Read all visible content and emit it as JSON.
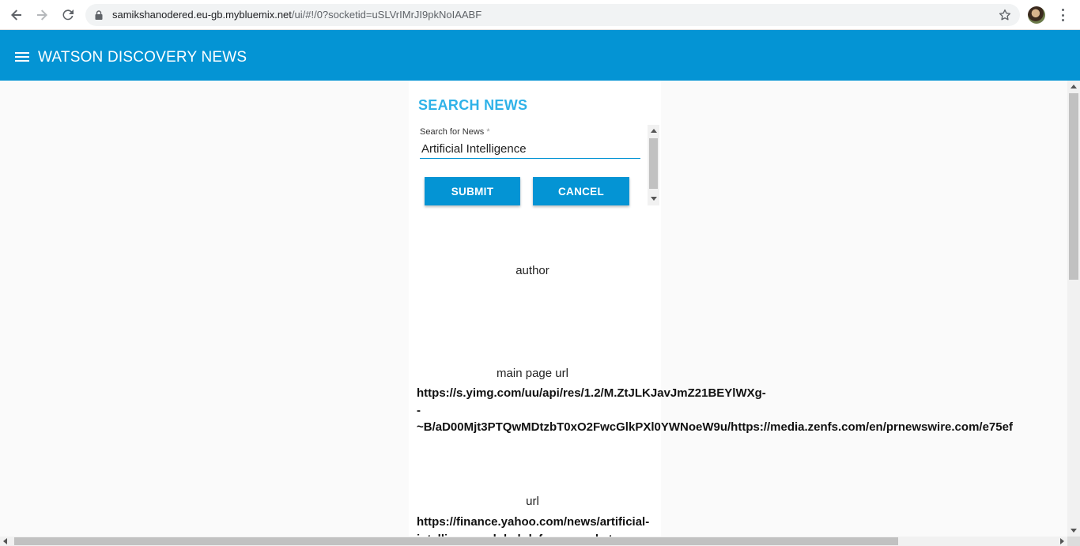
{
  "browser": {
    "url_host": "samikshanodered.eu-gb.mybluemix.net",
    "url_path": "/ui/#!/0?socketid=uSLVrIMrJI9pkNoIAABF"
  },
  "app": {
    "title": "WATSON DISCOVERY NEWS",
    "accent_color": "#0494d4"
  },
  "search": {
    "heading": "SEARCH NEWS",
    "field_label": "Search for News",
    "required_marker": "*",
    "value": "Artificial Intelligence",
    "submit_label": "SUBMIT",
    "cancel_label": "CANCEL"
  },
  "results": {
    "author_label": "author",
    "main_page_url_label": "main page url",
    "main_page_url_lines": [
      "https://s.yimg.com/uu/api/res/1.2/M.ZtJLKJavJmZ21BEYlWXg-",
      "-",
      "~B/aD00Mjt3PTQwMDtzbT0xO2FwcGlkPXl0YWNoeW9u/https://media.zenfs.com/en/prnewswire.com/e75ef"
    ],
    "url_label": "url",
    "url_lines": [
      "https://finance.yahoo.com/news/artificial-",
      "intelligence-global-defense-market"
    ]
  },
  "icons": {
    "back": "arrow-left-icon",
    "forward": "arrow-right-icon",
    "reload": "reload-icon",
    "lock": "lock-icon",
    "bookmark": "star-icon",
    "menu": "hamburger-menu-icon",
    "more": "kebab-menu-icon"
  }
}
